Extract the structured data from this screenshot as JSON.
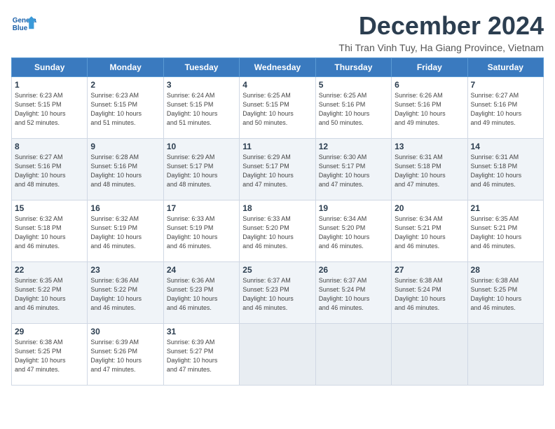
{
  "header": {
    "logo_line1": "General",
    "logo_line2": "Blue",
    "month_title": "December 2024",
    "location": "Thi Tran Vinh Tuy, Ha Giang Province, Vietnam"
  },
  "weekdays": [
    "Sunday",
    "Monday",
    "Tuesday",
    "Wednesday",
    "Thursday",
    "Friday",
    "Saturday"
  ],
  "weeks": [
    [
      {
        "day": "1",
        "info": "Sunrise: 6:23 AM\nSunset: 5:15 PM\nDaylight: 10 hours\nand 52 minutes."
      },
      {
        "day": "2",
        "info": "Sunrise: 6:23 AM\nSunset: 5:15 PM\nDaylight: 10 hours\nand 51 minutes."
      },
      {
        "day": "3",
        "info": "Sunrise: 6:24 AM\nSunset: 5:15 PM\nDaylight: 10 hours\nand 51 minutes."
      },
      {
        "day": "4",
        "info": "Sunrise: 6:25 AM\nSunset: 5:15 PM\nDaylight: 10 hours\nand 50 minutes."
      },
      {
        "day": "5",
        "info": "Sunrise: 6:25 AM\nSunset: 5:16 PM\nDaylight: 10 hours\nand 50 minutes."
      },
      {
        "day": "6",
        "info": "Sunrise: 6:26 AM\nSunset: 5:16 PM\nDaylight: 10 hours\nand 49 minutes."
      },
      {
        "day": "7",
        "info": "Sunrise: 6:27 AM\nSunset: 5:16 PM\nDaylight: 10 hours\nand 49 minutes."
      }
    ],
    [
      {
        "day": "8",
        "info": "Sunrise: 6:27 AM\nSunset: 5:16 PM\nDaylight: 10 hours\nand 48 minutes."
      },
      {
        "day": "9",
        "info": "Sunrise: 6:28 AM\nSunset: 5:16 PM\nDaylight: 10 hours\nand 48 minutes."
      },
      {
        "day": "10",
        "info": "Sunrise: 6:29 AM\nSunset: 5:17 PM\nDaylight: 10 hours\nand 48 minutes."
      },
      {
        "day": "11",
        "info": "Sunrise: 6:29 AM\nSunset: 5:17 PM\nDaylight: 10 hours\nand 47 minutes."
      },
      {
        "day": "12",
        "info": "Sunrise: 6:30 AM\nSunset: 5:17 PM\nDaylight: 10 hours\nand 47 minutes."
      },
      {
        "day": "13",
        "info": "Sunrise: 6:31 AM\nSunset: 5:18 PM\nDaylight: 10 hours\nand 47 minutes."
      },
      {
        "day": "14",
        "info": "Sunrise: 6:31 AM\nSunset: 5:18 PM\nDaylight: 10 hours\nand 46 minutes."
      }
    ],
    [
      {
        "day": "15",
        "info": "Sunrise: 6:32 AM\nSunset: 5:18 PM\nDaylight: 10 hours\nand 46 minutes."
      },
      {
        "day": "16",
        "info": "Sunrise: 6:32 AM\nSunset: 5:19 PM\nDaylight: 10 hours\nand 46 minutes."
      },
      {
        "day": "17",
        "info": "Sunrise: 6:33 AM\nSunset: 5:19 PM\nDaylight: 10 hours\nand 46 minutes."
      },
      {
        "day": "18",
        "info": "Sunrise: 6:33 AM\nSunset: 5:20 PM\nDaylight: 10 hours\nand 46 minutes."
      },
      {
        "day": "19",
        "info": "Sunrise: 6:34 AM\nSunset: 5:20 PM\nDaylight: 10 hours\nand 46 minutes."
      },
      {
        "day": "20",
        "info": "Sunrise: 6:34 AM\nSunset: 5:21 PM\nDaylight: 10 hours\nand 46 minutes."
      },
      {
        "day": "21",
        "info": "Sunrise: 6:35 AM\nSunset: 5:21 PM\nDaylight: 10 hours\nand 46 minutes."
      }
    ],
    [
      {
        "day": "22",
        "info": "Sunrise: 6:35 AM\nSunset: 5:22 PM\nDaylight: 10 hours\nand 46 minutes."
      },
      {
        "day": "23",
        "info": "Sunrise: 6:36 AM\nSunset: 5:22 PM\nDaylight: 10 hours\nand 46 minutes."
      },
      {
        "day": "24",
        "info": "Sunrise: 6:36 AM\nSunset: 5:23 PM\nDaylight: 10 hours\nand 46 minutes."
      },
      {
        "day": "25",
        "info": "Sunrise: 6:37 AM\nSunset: 5:23 PM\nDaylight: 10 hours\nand 46 minutes."
      },
      {
        "day": "26",
        "info": "Sunrise: 6:37 AM\nSunset: 5:24 PM\nDaylight: 10 hours\nand 46 minutes."
      },
      {
        "day": "27",
        "info": "Sunrise: 6:38 AM\nSunset: 5:24 PM\nDaylight: 10 hours\nand 46 minutes."
      },
      {
        "day": "28",
        "info": "Sunrise: 6:38 AM\nSunset: 5:25 PM\nDaylight: 10 hours\nand 46 minutes."
      }
    ],
    [
      {
        "day": "29",
        "info": "Sunrise: 6:38 AM\nSunset: 5:25 PM\nDaylight: 10 hours\nand 47 minutes."
      },
      {
        "day": "30",
        "info": "Sunrise: 6:39 AM\nSunset: 5:26 PM\nDaylight: 10 hours\nand 47 minutes."
      },
      {
        "day": "31",
        "info": "Sunrise: 6:39 AM\nSunset: 5:27 PM\nDaylight: 10 hours\nand 47 minutes."
      },
      {
        "day": "",
        "info": ""
      },
      {
        "day": "",
        "info": ""
      },
      {
        "day": "",
        "info": ""
      },
      {
        "day": "",
        "info": ""
      }
    ]
  ]
}
